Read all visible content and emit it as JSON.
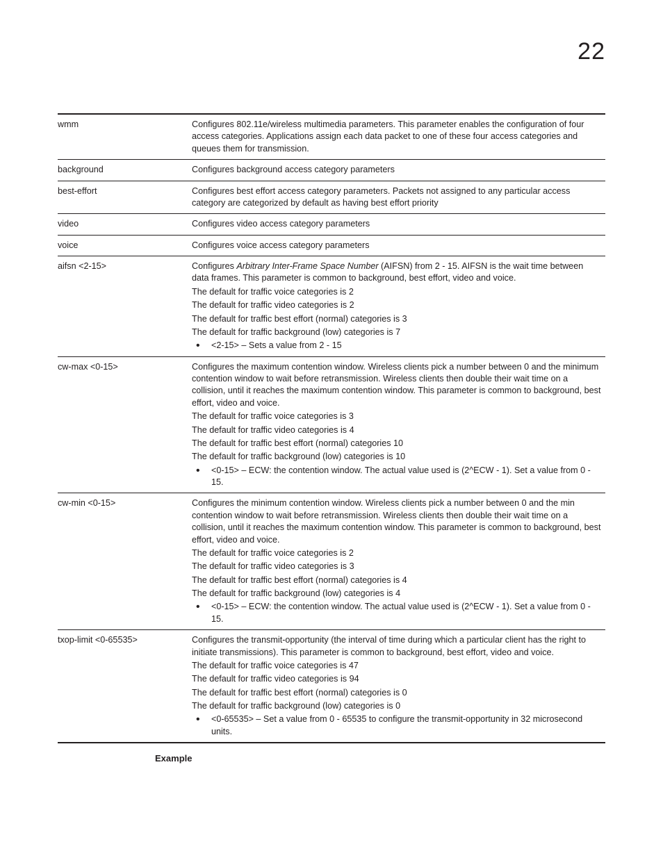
{
  "chapter_number": "22",
  "rows": [
    {
      "term": "wmm",
      "paras": [
        "Configures 802.11e/wireless multimedia parameters. This parameter enables the configuration of four access categories. Applications assign each data packet to one of these four access categories and queues them for transmission."
      ],
      "bullets": []
    },
    {
      "term": "background",
      "paras": [
        "Configures background access category parameters"
      ],
      "bullets": []
    },
    {
      "term": "best-effort",
      "paras": [
        "Configures best effort access category parameters. Packets not assigned to any particular access category are categorized by default as having best effort priority"
      ],
      "bullets": []
    },
    {
      "term": "video",
      "paras": [
        "Configures video access category parameters"
      ],
      "bullets": []
    },
    {
      "term": "voice",
      "paras": [
        "Configures voice access category parameters"
      ],
      "bullets": []
    },
    {
      "term": "aifsn <2-15>",
      "paras_html": true,
      "paras": [
        "Configures <span class=\"ital\">Arbitrary Inter-Frame Space Number</span> (AIFSN) from 2 - 15. AIFSN is the wait time between data frames. This parameter is common to background, best effort, video and voice.",
        "The default for traffic voice categories is 2",
        "The default for traffic video categories is 2",
        "The default for traffic best effort (normal) categories is 3",
        "The default for traffic background (low) categories is 7"
      ],
      "bullets": [
        "<2-15> – Sets a value from 2 - 15"
      ]
    },
    {
      "term": "cw-max <0-15>",
      "paras": [
        "Configures the maximum contention window. Wireless clients pick a number between 0 and the minimum contention window to wait before retransmission. Wireless clients then double their wait time on a collision, until it reaches the maximum contention window. This parameter is common to background, best effort, video and voice.",
        "The default for traffic voice categories is 3",
        "The default for traffic video categories is 4",
        "The default for traffic best effort (normal) categories 10",
        "The default for traffic background (low) categories is 10"
      ],
      "bullets": [
        "<0-15> – ECW: the contention window. The actual value used is (2^ECW - 1). Set a value from 0 - 15."
      ]
    },
    {
      "term": "cw-min <0-15>",
      "paras": [
        "Configures the minimum contention window. Wireless clients pick a number between 0 and the min contention window to wait before retransmission. Wireless clients then double their wait time on a collision, until it reaches the maximum contention window. This parameter is common to background, best effort, video and voice.",
        "The default for traffic voice categories is 2",
        "The default for traffic video categories is 3",
        "The default for traffic best effort (normal) categories is 4",
        "The default for traffic background (low) categories is 4"
      ],
      "bullets": [
        "<0-15> – ECW: the contention window. The actual value used is (2^ECW - 1). Set a value from 0 - 15."
      ]
    },
    {
      "term": "txop-limit <0-65535>",
      "paras": [
        "Configures the transmit-opportunity (the interval of time during which a particular client has the right to initiate transmissions). This parameter is common to background, best effort, video and voice.",
        "The default for traffic voice categories is 47",
        "The default for traffic video categories is 94",
        "The default for traffic best effort (normal) categories is 0",
        "The default for traffic background (low) categories is 0"
      ],
      "bullets": [
        "<0-65535> – Set a value from 0 - 65535 to configure the transmit-opportunity in 32 microsecond units."
      ]
    }
  ],
  "example_heading": "Example"
}
